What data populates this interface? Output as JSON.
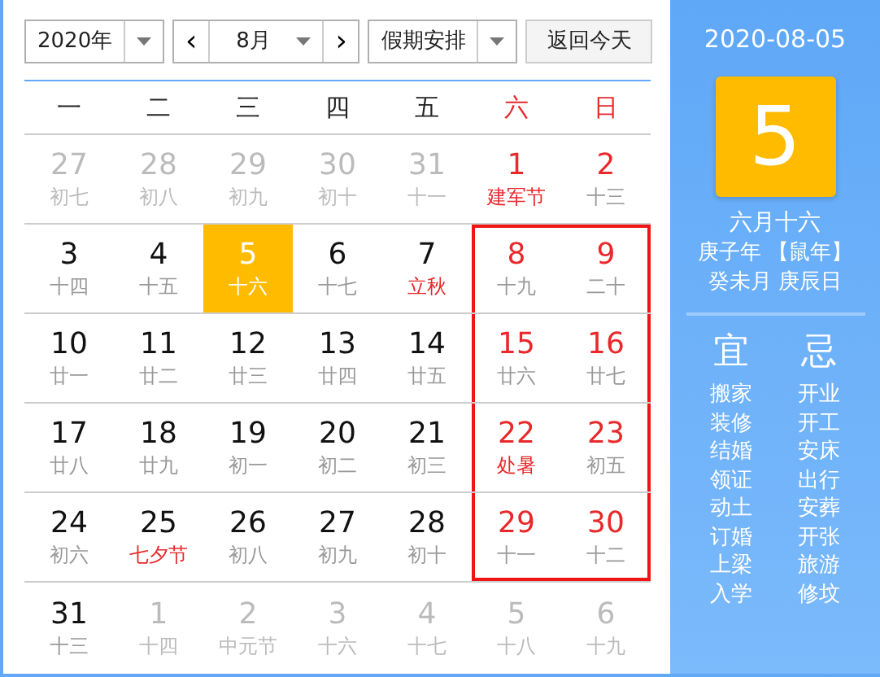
{
  "toolbar": {
    "year": "2020年",
    "prev": "‹",
    "month": "8月",
    "next": "›",
    "holiday_select": "假期安排",
    "today_button": "返回今天"
  },
  "weekdays": [
    {
      "label": "一",
      "weekend": false
    },
    {
      "label": "二",
      "weekend": false
    },
    {
      "label": "三",
      "weekend": false
    },
    {
      "label": "四",
      "weekend": false
    },
    {
      "label": "五",
      "weekend": false
    },
    {
      "label": "六",
      "weekend": true
    },
    {
      "label": "日",
      "weekend": true
    }
  ],
  "weeks": [
    {
      "weekend_boxed": false,
      "days": [
        {
          "day": "27",
          "lunar": "初七",
          "other_month": true,
          "holiday": false,
          "festival": false,
          "selected": false
        },
        {
          "day": "28",
          "lunar": "初八",
          "other_month": true,
          "holiday": false,
          "festival": false,
          "selected": false
        },
        {
          "day": "29",
          "lunar": "初九",
          "other_month": true,
          "holiday": false,
          "festival": false,
          "selected": false
        },
        {
          "day": "30",
          "lunar": "初十",
          "other_month": true,
          "holiday": false,
          "festival": false,
          "selected": false
        },
        {
          "day": "31",
          "lunar": "十一",
          "other_month": true,
          "holiday": false,
          "festival": false,
          "selected": false
        },
        {
          "day": "1",
          "lunar": "建军节",
          "other_month": false,
          "holiday": true,
          "festival": true,
          "selected": false
        },
        {
          "day": "2",
          "lunar": "十三",
          "other_month": false,
          "holiday": true,
          "festival": false,
          "selected": false
        }
      ]
    },
    {
      "weekend_boxed": true,
      "days": [
        {
          "day": "3",
          "lunar": "十四",
          "other_month": false,
          "holiday": false,
          "festival": false,
          "selected": false
        },
        {
          "day": "4",
          "lunar": "十五",
          "other_month": false,
          "holiday": false,
          "festival": false,
          "selected": false
        },
        {
          "day": "5",
          "lunar": "十六",
          "other_month": false,
          "holiday": false,
          "festival": false,
          "selected": true
        },
        {
          "day": "6",
          "lunar": "十七",
          "other_month": false,
          "holiday": false,
          "festival": false,
          "selected": false
        },
        {
          "day": "7",
          "lunar": "立秋",
          "other_month": false,
          "holiday": false,
          "festival": true,
          "selected": false
        },
        {
          "day": "8",
          "lunar": "十九",
          "other_month": false,
          "holiday": true,
          "festival": false,
          "selected": false
        },
        {
          "day": "9",
          "lunar": "二十",
          "other_month": false,
          "holiday": true,
          "festival": false,
          "selected": false
        }
      ]
    },
    {
      "weekend_boxed": true,
      "days": [
        {
          "day": "10",
          "lunar": "廿一",
          "other_month": false,
          "holiday": false,
          "festival": false,
          "selected": false
        },
        {
          "day": "11",
          "lunar": "廿二",
          "other_month": false,
          "holiday": false,
          "festival": false,
          "selected": false
        },
        {
          "day": "12",
          "lunar": "廿三",
          "other_month": false,
          "holiday": false,
          "festival": false,
          "selected": false
        },
        {
          "day": "13",
          "lunar": "廿四",
          "other_month": false,
          "holiday": false,
          "festival": false,
          "selected": false
        },
        {
          "day": "14",
          "lunar": "廿五",
          "other_month": false,
          "holiday": false,
          "festival": false,
          "selected": false
        },
        {
          "day": "15",
          "lunar": "廿六",
          "other_month": false,
          "holiday": true,
          "festival": false,
          "selected": false
        },
        {
          "day": "16",
          "lunar": "廿七",
          "other_month": false,
          "holiday": true,
          "festival": false,
          "selected": false
        }
      ]
    },
    {
      "weekend_boxed": true,
      "days": [
        {
          "day": "17",
          "lunar": "廿八",
          "other_month": false,
          "holiday": false,
          "festival": false,
          "selected": false
        },
        {
          "day": "18",
          "lunar": "廿九",
          "other_month": false,
          "holiday": false,
          "festival": false,
          "selected": false
        },
        {
          "day": "19",
          "lunar": "初一",
          "other_month": false,
          "holiday": false,
          "festival": false,
          "selected": false
        },
        {
          "day": "20",
          "lunar": "初二",
          "other_month": false,
          "holiday": false,
          "festival": false,
          "selected": false
        },
        {
          "day": "21",
          "lunar": "初三",
          "other_month": false,
          "holiday": false,
          "festival": false,
          "selected": false
        },
        {
          "day": "22",
          "lunar": "处暑",
          "other_month": false,
          "holiday": true,
          "festival": true,
          "selected": false
        },
        {
          "day": "23",
          "lunar": "初五",
          "other_month": false,
          "holiday": true,
          "festival": false,
          "selected": false
        }
      ]
    },
    {
      "weekend_boxed": true,
      "days": [
        {
          "day": "24",
          "lunar": "初六",
          "other_month": false,
          "holiday": false,
          "festival": false,
          "selected": false
        },
        {
          "day": "25",
          "lunar": "七夕节",
          "other_month": false,
          "holiday": false,
          "festival": true,
          "selected": false
        },
        {
          "day": "26",
          "lunar": "初八",
          "other_month": false,
          "holiday": false,
          "festival": false,
          "selected": false
        },
        {
          "day": "27",
          "lunar": "初九",
          "other_month": false,
          "holiday": false,
          "festival": false,
          "selected": false
        },
        {
          "day": "28",
          "lunar": "初十",
          "other_month": false,
          "holiday": false,
          "festival": false,
          "selected": false
        },
        {
          "day": "29",
          "lunar": "十一",
          "other_month": false,
          "holiday": true,
          "festival": false,
          "selected": false
        },
        {
          "day": "30",
          "lunar": "十二",
          "other_month": false,
          "holiday": true,
          "festival": false,
          "selected": false
        }
      ]
    },
    {
      "weekend_boxed": false,
      "days": [
        {
          "day": "31",
          "lunar": "十三",
          "other_month": false,
          "holiday": false,
          "festival": false,
          "selected": false
        },
        {
          "day": "1",
          "lunar": "十四",
          "other_month": true,
          "holiday": false,
          "festival": false,
          "selected": false
        },
        {
          "day": "2",
          "lunar": "中元节",
          "other_month": true,
          "holiday": false,
          "festival": false,
          "selected": false
        },
        {
          "day": "3",
          "lunar": "十六",
          "other_month": true,
          "holiday": false,
          "festival": false,
          "selected": false
        },
        {
          "day": "4",
          "lunar": "十七",
          "other_month": true,
          "holiday": false,
          "festival": false,
          "selected": false
        },
        {
          "day": "5",
          "lunar": "十八",
          "other_month": true,
          "holiday": false,
          "festival": false,
          "selected": false
        },
        {
          "day": "6",
          "lunar": "十九",
          "other_month": true,
          "holiday": false,
          "festival": false,
          "selected": false
        }
      ]
    }
  ],
  "detail": {
    "date": "2020-08-05",
    "day": "5",
    "lunar_date": "六月十六",
    "year_line": "庚子年 【鼠年】",
    "ganzhi": "癸未月 庚辰日",
    "good": {
      "title": "宜",
      "items": [
        "搬家",
        "装修",
        "结婚",
        "领证",
        "动土",
        "订婚",
        "上梁",
        "入学"
      ]
    },
    "bad": {
      "title": "忌",
      "items": [
        "开业",
        "开工",
        "安床",
        "出行",
        "安葬",
        "开张",
        "旅游",
        "修坟"
      ]
    }
  }
}
